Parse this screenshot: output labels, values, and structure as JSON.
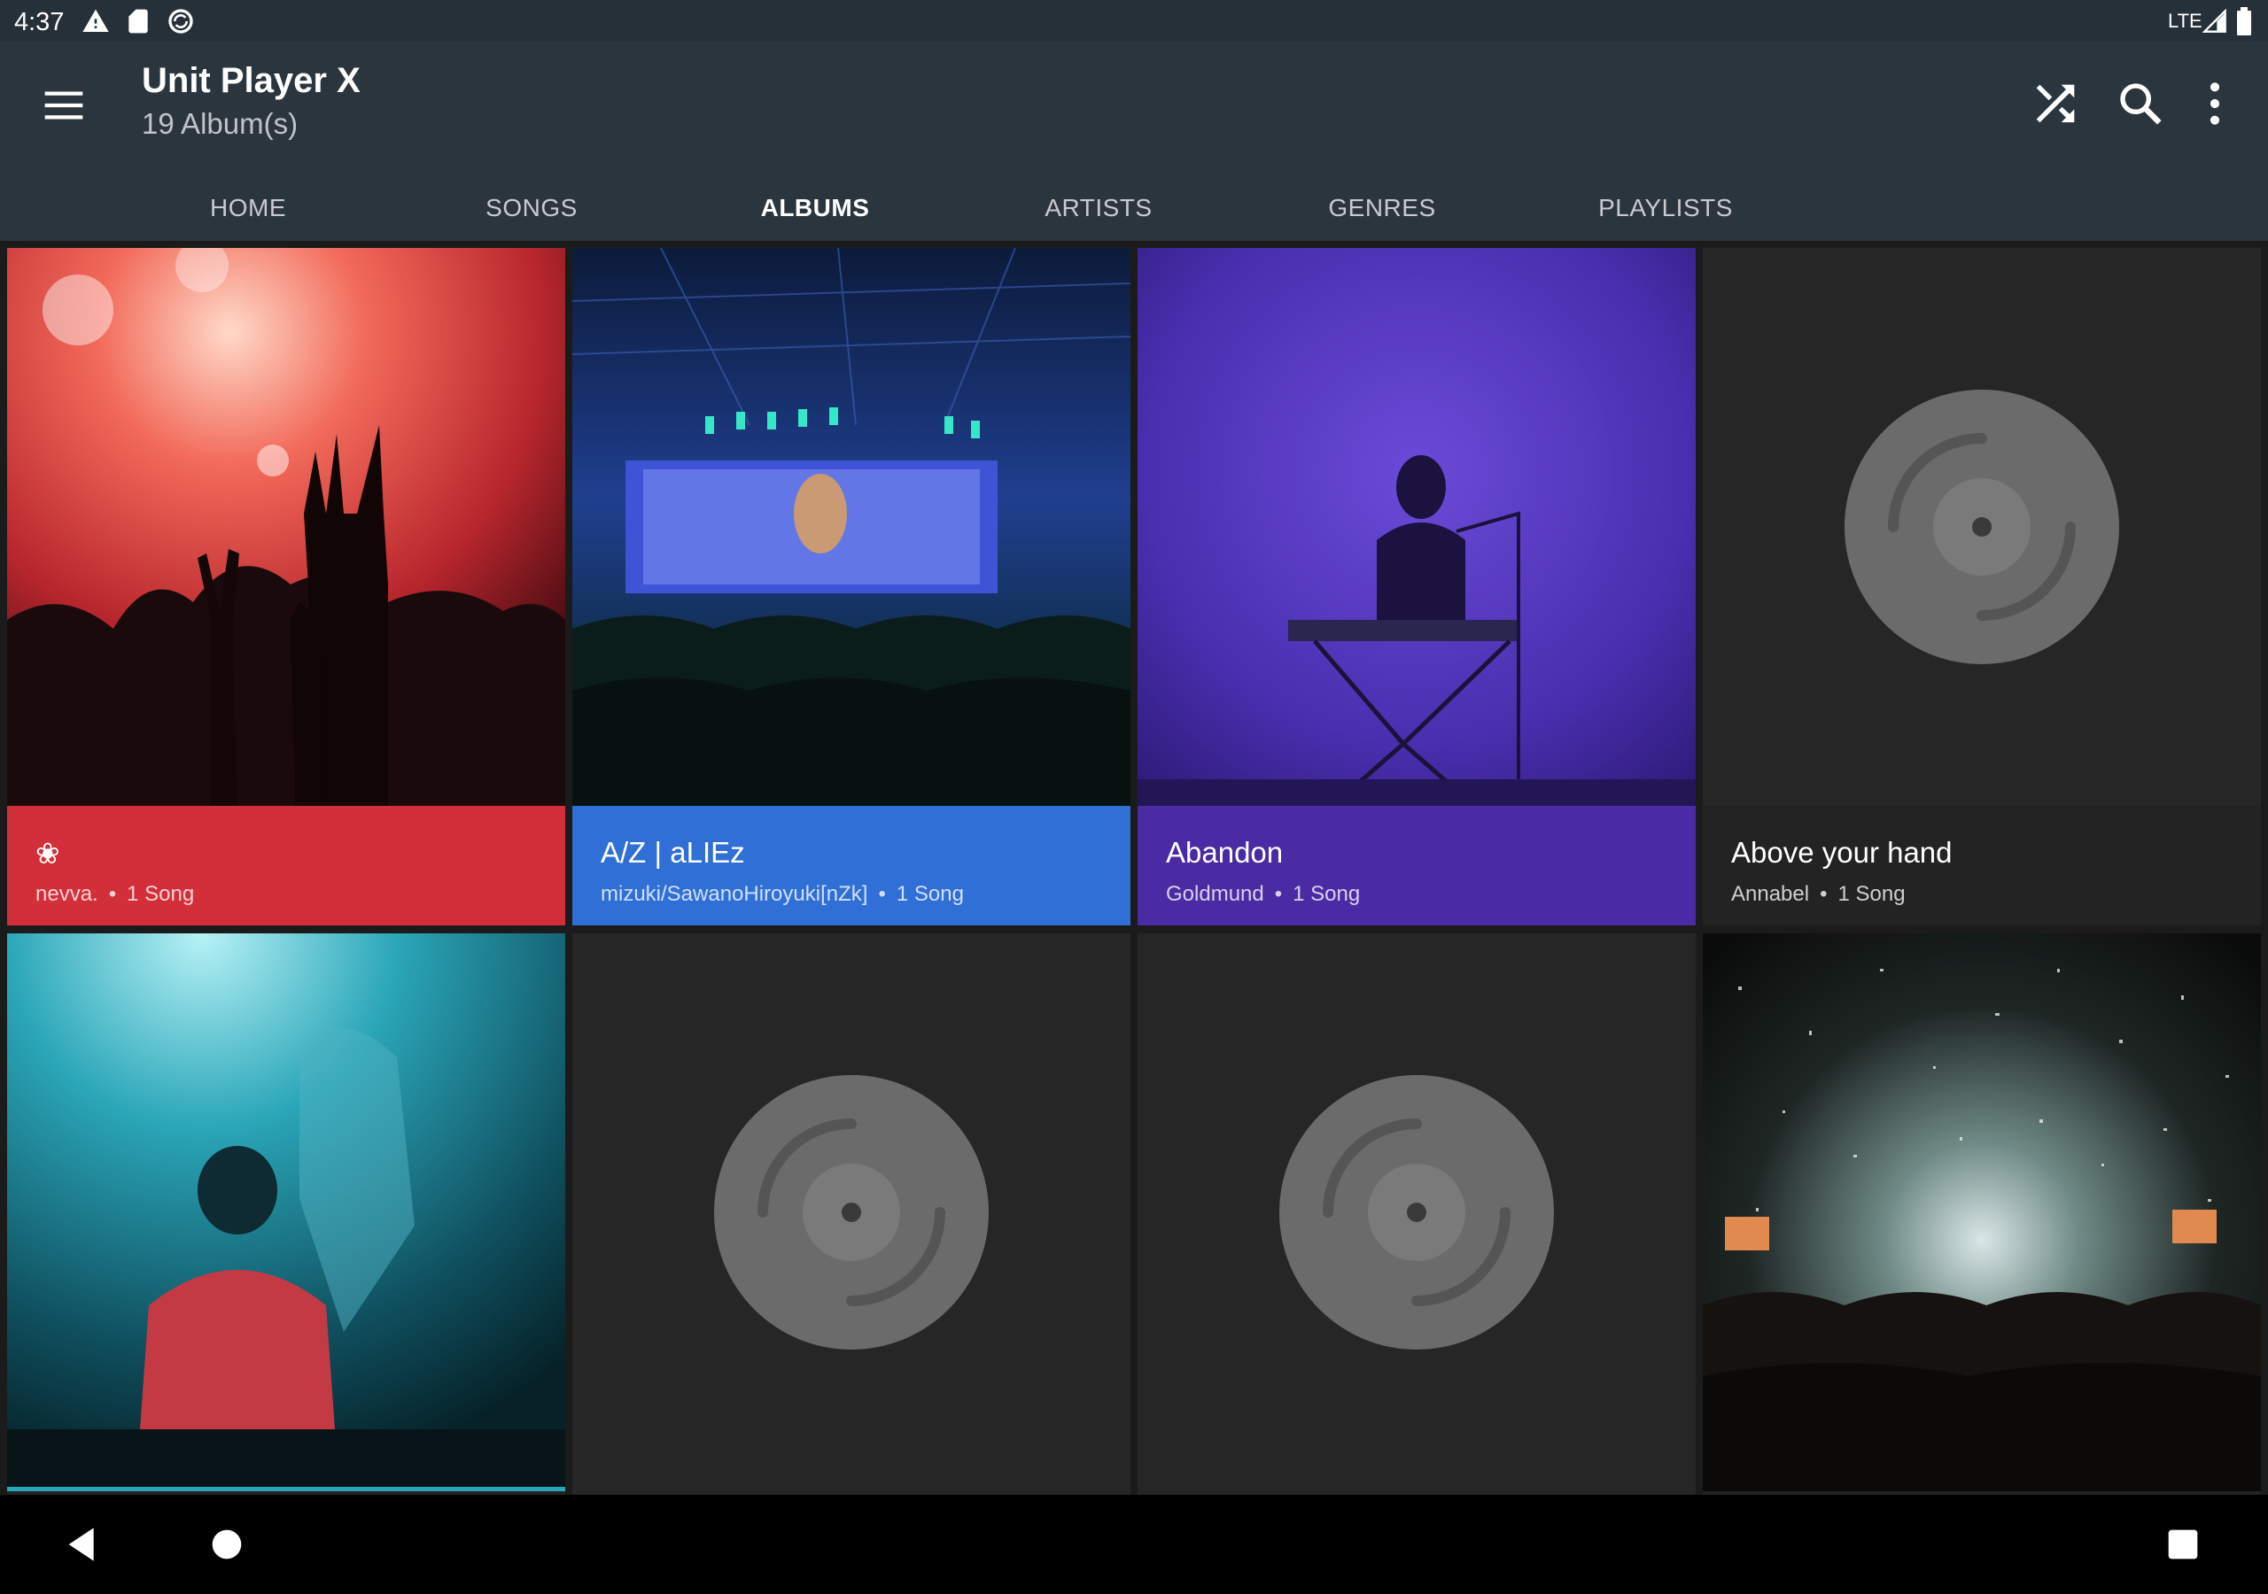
{
  "status": {
    "time": "4:37",
    "network": "LTE",
    "icons": [
      "alert-icon",
      "sd-card-icon",
      "sync-icon",
      "signal-icon",
      "battery-icon"
    ]
  },
  "appbar": {
    "title": "Unit Player X",
    "subtitle": "19 Album(s)",
    "actions": [
      "shuffle-icon",
      "search-icon",
      "more-vert-icon"
    ]
  },
  "tabs": [
    {
      "label": "HOME"
    },
    {
      "label": "SONGS"
    },
    {
      "label": "ALBUMS",
      "active": true
    },
    {
      "label": "ARTISTS"
    },
    {
      "label": "GENRES"
    },
    {
      "label": "PLAYLISTS"
    }
  ],
  "colors": {
    "accent": "#e91e4c",
    "toolbar": "#2b353d",
    "statusbar": "#263038"
  },
  "albums": [
    {
      "title": "❀",
      "artist": "nevva.",
      "count": "1 Song",
      "color": "#d32f3a",
      "art": "red-concert-crowd"
    },
    {
      "title": "A/Z | aLIEz",
      "artist": "mizuki/SawanoHiroyuki[nZk]",
      "count": "1 Song",
      "color": "#2f6fd6",
      "art": "blue-stadium-concert"
    },
    {
      "title": "Abandon",
      "artist": "Goldmund",
      "count": "1 Song",
      "color": "#4a2ba3",
      "art": "purple-keyboard-player"
    },
    {
      "title": "Above your hand",
      "artist": "Annabel",
      "count": "1 Song",
      "color": "#232323",
      "art": "placeholder-disc"
    },
    {
      "art": "teal-dj"
    },
    {
      "art": "placeholder-disc"
    },
    {
      "art": "placeholder-disc"
    },
    {
      "art": "confetti-crowd"
    }
  ],
  "separator": "•",
  "nav": [
    "back-icon",
    "home-icon",
    "recents-icon"
  ]
}
